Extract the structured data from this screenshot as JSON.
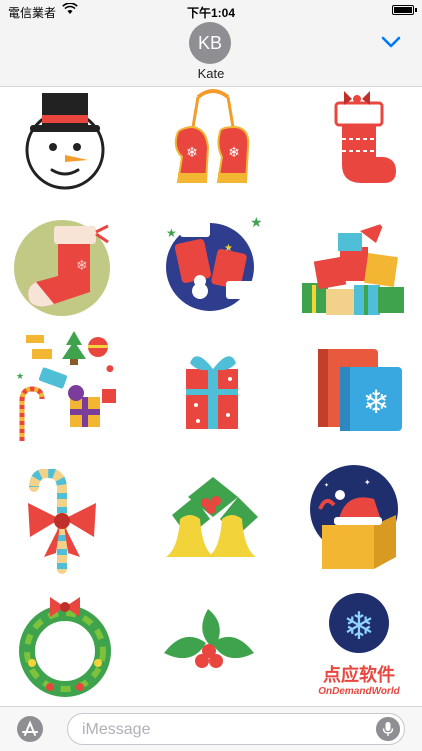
{
  "status_bar": {
    "carrier": "電信業者",
    "time": "下午1:04"
  },
  "contact": {
    "initials": "KB",
    "name": "Kate"
  },
  "stickers": [
    {
      "id": "snowman",
      "name": "snowman-sticker"
    },
    {
      "id": "mittens",
      "name": "mittens-sticker"
    },
    {
      "id": "stocking",
      "name": "stocking-sticker"
    },
    {
      "id": "stocking-circle",
      "name": "stocking-circle-sticker"
    },
    {
      "id": "gifts-globe",
      "name": "gifts-globe-sticker"
    },
    {
      "id": "present-pile",
      "name": "present-pile-sticker"
    },
    {
      "id": "confetti",
      "name": "christmas-confetti-sticker"
    },
    {
      "id": "gift-box",
      "name": "gift-box-sticker"
    },
    {
      "id": "books",
      "name": "books-sticker"
    },
    {
      "id": "candy-cane-bow",
      "name": "candy-cane-bow-sticker"
    },
    {
      "id": "bells",
      "name": "bells-sticker"
    },
    {
      "id": "santa-box",
      "name": "santa-box-sticker"
    },
    {
      "id": "wreath",
      "name": "wreath-sticker"
    },
    {
      "id": "holly",
      "name": "holly-sticker"
    },
    {
      "id": "brand-logo",
      "name": "brand-logo-sticker"
    }
  ],
  "brand": {
    "name_cn": "点应软件",
    "name_en": "OnDemandWorld"
  },
  "input": {
    "placeholder": "iMessage"
  },
  "colors": {
    "accent": "#007aff",
    "avatar": "#8e8e93",
    "red": "#e8463e",
    "green": "#3fa34d",
    "gold": "#f2b632"
  }
}
